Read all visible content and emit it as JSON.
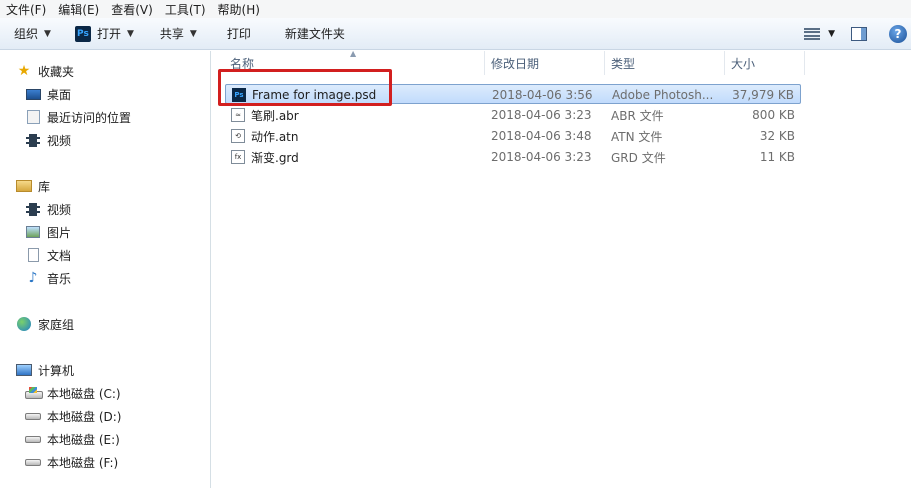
{
  "menubar": {
    "items": [
      "文件(F)",
      "编辑(E)",
      "查看(V)",
      "工具(T)",
      "帮助(H)"
    ]
  },
  "toolbar": {
    "organize": "组织",
    "open": "打开",
    "share": "共享",
    "print": "打印",
    "new_folder": "新建文件夹"
  },
  "sidebar": {
    "favorites": {
      "title": "收藏夹",
      "items": [
        "桌面",
        "最近访问的位置",
        "视频"
      ]
    },
    "libraries": {
      "title": "库",
      "items": [
        "视频",
        "图片",
        "文档",
        "音乐"
      ]
    },
    "homegroup": "家庭组",
    "computer": {
      "title": "计算机",
      "drives": [
        "本地磁盘 (C:)",
        "本地磁盘 (D:)",
        "本地磁盘 (E:)",
        "本地磁盘 (F:)"
      ]
    }
  },
  "columns": {
    "name": "名称",
    "date": "修改日期",
    "type": "类型",
    "size": "大小"
  },
  "files": [
    {
      "icon": "psd-file-icon",
      "icon_text": "Ps",
      "name": "Frame for image.psd",
      "date": "2018-04-06 3:56",
      "type": "Adobe Photosh...",
      "size": "37,979 KB",
      "selected": true
    },
    {
      "icon": "abr-file-icon",
      "icon_text": "≈",
      "name": "笔刷.abr",
      "date": "2018-04-06 3:23",
      "type": "ABR 文件",
      "size": "800 KB",
      "selected": false
    },
    {
      "icon": "atn-file-icon",
      "icon_text": "⟲",
      "name": "动作.atn",
      "date": "2018-04-06 3:48",
      "type": "ATN 文件",
      "size": "32 KB",
      "selected": false
    },
    {
      "icon": "grd-file-icon",
      "icon_text": "fx",
      "name": "渐变.grd",
      "date": "2018-04-06 3:23",
      "type": "GRD 文件",
      "size": "11 KB",
      "selected": false
    }
  ],
  "colors": {
    "annotation": "#d21f1f",
    "selection": "#c1dbfc",
    "toolbar": "#e3ecf6"
  }
}
